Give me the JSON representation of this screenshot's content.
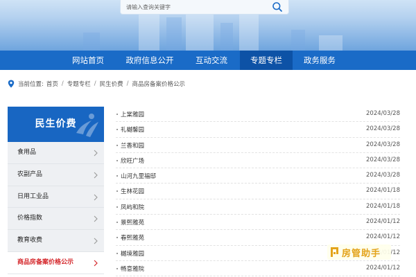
{
  "search": {
    "placeholder": "请输入查询关键字"
  },
  "nav": {
    "items": [
      {
        "label": "网站首页"
      },
      {
        "label": "政府信息公开"
      },
      {
        "label": "互动交流"
      },
      {
        "label": "专题专栏"
      },
      {
        "label": "政务服务"
      }
    ],
    "active_index": 3
  },
  "breadcrumb": {
    "prefix": "当前位置:",
    "items": [
      "首页",
      "专题专栏",
      "民生价费",
      "商品房备案价格公示"
    ],
    "separator": "/"
  },
  "sidebar": {
    "title": "民生价费",
    "items": [
      {
        "label": "食用品"
      },
      {
        "label": "农副产品"
      },
      {
        "label": "日用工业品"
      },
      {
        "label": "价格指数"
      },
      {
        "label": "教育收费"
      },
      {
        "label": "商品房备案价格公示"
      }
    ],
    "active_index": 5
  },
  "list": [
    {
      "name": "上棠雅园",
      "date": "2024/03/28"
    },
    {
      "name": "礼樾馨园",
      "date": "2024/03/28"
    },
    {
      "name": "兰香和园",
      "date": "2024/03/28"
    },
    {
      "name": "欣旺广场",
      "date": "2024/03/28"
    },
    {
      "name": "山河九里福邸",
      "date": "2024/03/28"
    },
    {
      "name": "生林花园",
      "date": "2024/01/18"
    },
    {
      "name": "凤屿和院",
      "date": "2024/01/18"
    },
    {
      "name": "景熙雅苑",
      "date": "2024/01/12"
    },
    {
      "name": "春熙雅苑",
      "date": "2024/01/12"
    },
    {
      "name": "樾境雅园",
      "date": "2024/01/12"
    },
    {
      "name": "畅意雅院",
      "date": "2024/01/12"
    }
  ],
  "watermark": {
    "text": "房管助手"
  },
  "colors": {
    "nav_bg": "#1a6bc7",
    "nav_active": "#0d52a6",
    "sidebar_head": "#1866c2",
    "active_text": "#d4262a"
  }
}
